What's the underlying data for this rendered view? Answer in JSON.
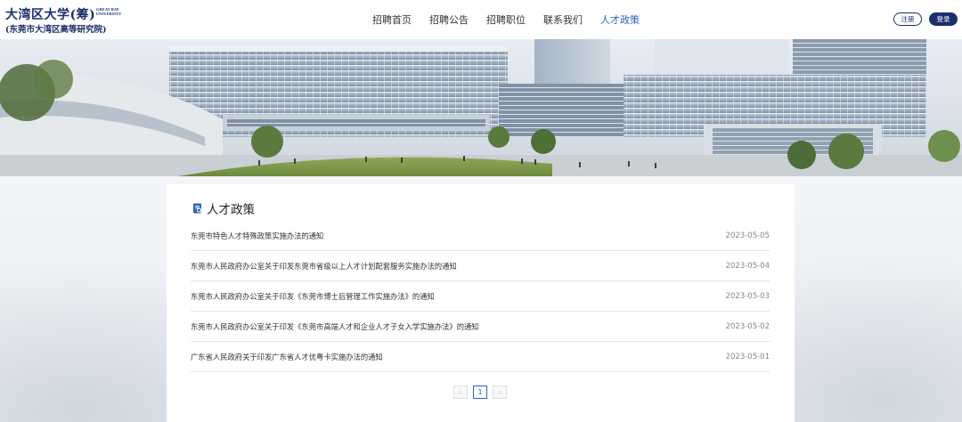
{
  "logo": {
    "name_cn": "大湾区大学(筹)",
    "name_en": "GREAT BAY UNIVERSITY",
    "subtitle": "(东莞市大湾区高等研究院)"
  },
  "nav": {
    "items": [
      {
        "label": "招聘首页"
      },
      {
        "label": "招聘公告"
      },
      {
        "label": "招聘职位"
      },
      {
        "label": "联系我们"
      },
      {
        "label": "人才政策",
        "active": true
      }
    ]
  },
  "auth": {
    "register": "注册",
    "login": "登录"
  },
  "section": {
    "title": "人才政策",
    "icon": "document-icon"
  },
  "policies": [
    {
      "title": "东莞市特色人才特殊政策实施办法的通知",
      "date": "2023-05-05"
    },
    {
      "title": "东莞市人民政府办公室关于印发东莞市省级以上人才计划配套服务实施办法的通知",
      "date": "2023-05-04"
    },
    {
      "title": "东莞市人民政府办公室关于印发《东莞市博士后管理工作实施办法》的通知",
      "date": "2023-05-03"
    },
    {
      "title": "东莞市人民政府办公室关于印发《东莞市高端人才和企业人才子女入学实施办法》的通知",
      "date": "2023-05-02"
    },
    {
      "title": "广东省人民政府关于印发广东省人才优粤卡实施办法的通知",
      "date": "2023-05-01"
    }
  ],
  "pagination": {
    "prev": "‹",
    "current": "1",
    "next": "›"
  },
  "colors": {
    "brand": "#1a2f6b",
    "active_nav": "#2d62b8"
  }
}
